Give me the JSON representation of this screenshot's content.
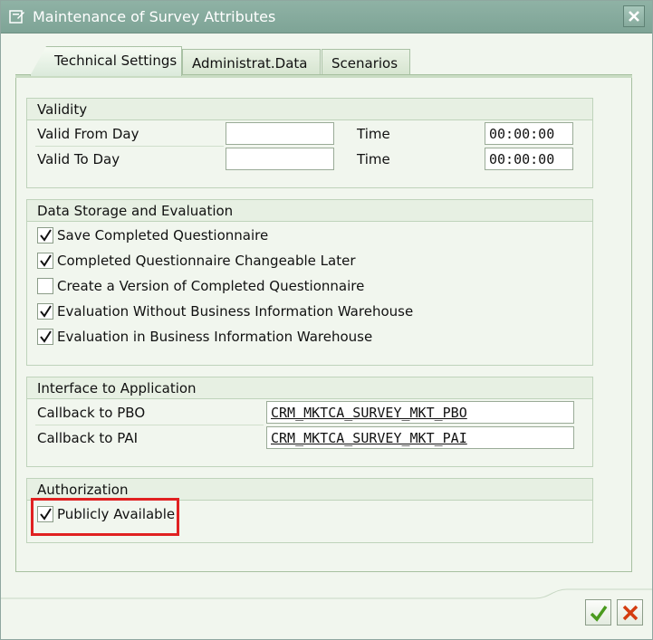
{
  "window": {
    "title": "Maintenance of Survey Attributes"
  },
  "tabs": [
    {
      "label": "Technical Settings"
    },
    {
      "label": "Administrat.Data"
    },
    {
      "label": "Scenarios"
    }
  ],
  "validity": {
    "heading": "Validity",
    "from_label": "Valid From Day",
    "from_value": "",
    "from_time_label": "Time",
    "from_time_value": "00:00:00",
    "to_label": "Valid To Day",
    "to_value": "",
    "to_time_label": "Time",
    "to_time_value": "00:00:00"
  },
  "storage": {
    "heading": "Data Storage and Evaluation",
    "items": [
      {
        "label": "Save Completed Questionnaire",
        "checked": true
      },
      {
        "label": "Completed Questionnaire Changeable Later",
        "checked": true
      },
      {
        "label": "Create a Version of Completed Questionnaire",
        "checked": false
      },
      {
        "label": "Evaluation Without Business Information Warehouse",
        "checked": true
      },
      {
        "label": "Evaluation in Business Information Warehouse",
        "checked": true
      }
    ]
  },
  "interface": {
    "heading": "Interface to Application",
    "pbo_label": "Callback to PBO",
    "pbo_value": "CRM_MKTCA_SURVEY_MKT_PBO",
    "pai_label": "Callback to PAI",
    "pai_value": "CRM_MKTCA_SURVEY_MKT_PAI"
  },
  "authorization": {
    "heading": "Authorization",
    "public_label": "Publicly Available",
    "public_checked": true
  },
  "icons": {
    "title": "edit-window-icon",
    "close": "close-icon",
    "confirm": "checkmark-icon",
    "cancel": "cancel-x-icon"
  },
  "colors": {
    "titlebar": "#7ea496",
    "highlight": "#e02121",
    "confirm": "#4a9a1e",
    "cancel": "#d43c10"
  }
}
